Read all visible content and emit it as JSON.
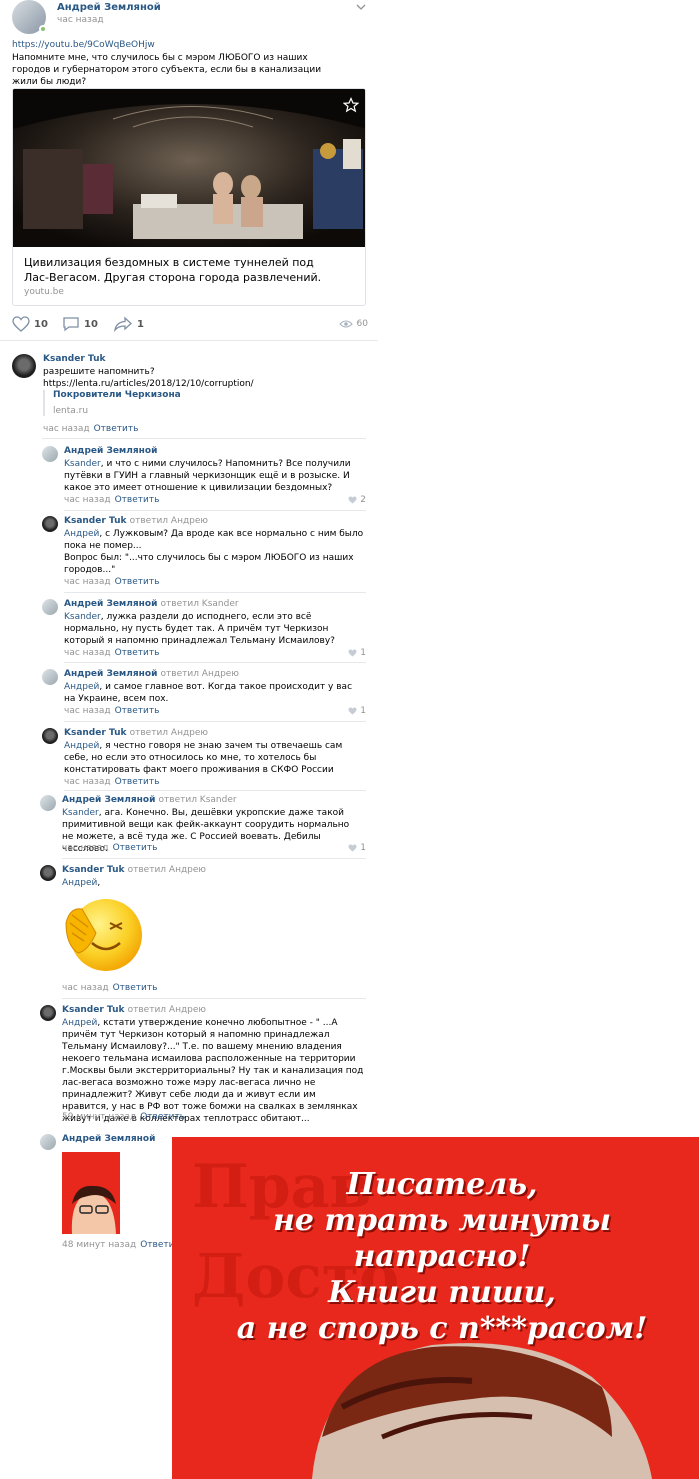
{
  "post": {
    "author": "Андрей Земляной",
    "time": "час назад",
    "link": "https://youtu.be/9CoWqBeOHjw",
    "text": "Напомните мне, что случилось бы с мэром ЛЮБОГО из наших городов и губернатором этого субъекта, если бы в канализации жили бы люди?",
    "card": {
      "title": "Цивилизация бездомных в системе туннелей под Лас-Вегасом. Другая сторона города развлечений.",
      "domain": "youtu.be"
    },
    "actions": {
      "likes": "10",
      "comments": "10",
      "shares": "1",
      "views": "60"
    }
  },
  "comments": [
    {
      "author": "Ksander Tuk",
      "text": "разрешите напомнить?",
      "link": "https://lenta.ru/articles/2018/12/10/corruption/",
      "quote_title": "Покровители Черкизона",
      "quote_domain": "lenta.ru",
      "time": "час назад",
      "reply": "Ответить"
    },
    {
      "author": "Андрей Земляной",
      "mention": "Ksander",
      "text": ", и что с ними случилось? Напомнить? Все получили путёвки в ГУИН а главный черкизонщик ещё и в розыске. И какое это имеет отношение к цивилизации бездомных?",
      "time": "час назад",
      "reply": "Ответить",
      "likes": "2"
    },
    {
      "author": "Ksander Tuk",
      "replied": "ответил Андрею",
      "mention": "Андрей",
      "text": ", с Лужковым? Да вроде как все нормально с ним было пока не помер...\nВопрос был: \"...что случилось бы с мэром ЛЮБОГО из наших городов...\"",
      "time": "час назад",
      "reply": "Ответить"
    },
    {
      "author": "Андрей Земляной",
      "replied": "ответил Ksander",
      "mention": "Ksander",
      "text": ", лужка раздели до исподнего, если это всё нормально, ну пусть будет так. А причём тут Черкизон который я напомню принадлежал Тельману Исмаилову?",
      "time": "час назад",
      "reply": "Ответить",
      "likes": "1"
    },
    {
      "author": "Андрей Земляной",
      "replied": "ответил Андрею",
      "mention": "Андрей",
      "text": ", и самое главное вот. Когда такое происходит у вас на Украине, всем пох.",
      "time": "час назад",
      "reply": "Ответить",
      "likes": "1"
    },
    {
      "author": "Ksander Tuk",
      "replied": "ответил Андрею",
      "mention": "Андрей",
      "text": ", я честно говоря не знаю зачем ты отвечаешь сам себе, но если это относилось ко мне, то хотелось бы констатировать факт моего проживания в СКФО России",
      "time": "час назад",
      "reply": "Ответить"
    },
    {
      "author": "Андрей Земляной",
      "replied": "ответил Ksander",
      "mention": "Ksander",
      "text": ", ага. Конечно. Вы, дешёвки укропские даже такой примитивной вещи как фейк-аккаунт соорудить нормально не можете, а всё туда же. С Россией воевать. Дебилы чесслово.",
      "time": "час назад",
      "reply": "Ответить",
      "likes": "1"
    },
    {
      "author": "Ksander Tuk",
      "replied": "ответил Андрею",
      "mention": "Андрей",
      "text": ",",
      "time": "час назад",
      "reply": "Ответить"
    },
    {
      "author": "Ksander Tuk",
      "replied": "ответил Андрею",
      "mention": "Андрей",
      "text": ", кстати утверждение конечно любопытное - \" ...А причём тут Черкизон который я напомню принадлежал Тельману Исмаилову?...\" Т.е. по вашему мнению владения некоего тельмана исмаилова расположенные на территории г.Москвы были экстерриториальны? Ну так и канализация под лас-вегаса возможно тоже мэру лас-вегаса лично не принадлежит? Живут себе люди да и живут если им нравится, у нас в РФ вот тоже бомжи на свалках в землянках живут и даже в коллекторах теплотрасс обитают...",
      "time": "59 минут назад",
      "reply": "Ответить"
    },
    {
      "author": "Андрей Земляной",
      "time": "48 минут назад",
      "reply": "Ответить"
    }
  ],
  "poster": {
    "text": "Писатель,\nне трать минуты\nнапрасно!\nКниги пиши,\nа не спорь с п***расом!"
  },
  "colors": {
    "link": "#2a5885",
    "muted": "#939393",
    "poster_red": "#e8281c",
    "online": "#8ac176"
  }
}
